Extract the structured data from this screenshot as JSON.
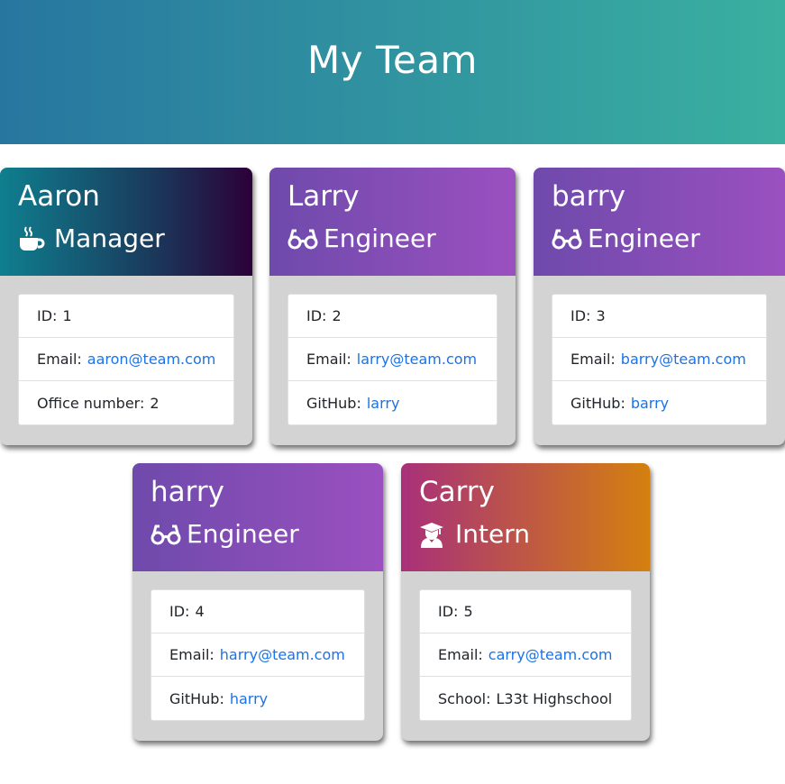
{
  "header": {
    "title": "My Team"
  },
  "labels": {
    "id": "ID:",
    "email": "Email:",
    "office": "Office number:",
    "github": "GitHub:",
    "school": "School:"
  },
  "team": [
    {
      "name": "Aaron",
      "role": "Manager",
      "icon": "coffee-cup-icon",
      "id": "1",
      "email": "aaron@team.com",
      "extra": "2"
    },
    {
      "name": "Larry",
      "role": "Engineer",
      "icon": "glasses-icon",
      "id": "2",
      "email": "larry@team.com",
      "extra": "larry"
    },
    {
      "name": "barry",
      "role": "Engineer",
      "icon": "glasses-icon",
      "id": "3",
      "email": "barry@team.com",
      "extra": "barry"
    },
    {
      "name": "harry",
      "role": "Engineer",
      "icon": "glasses-icon",
      "id": "4",
      "email": "harry@team.com",
      "extra": "harry"
    },
    {
      "name": "Carry",
      "role": "Intern",
      "icon": "graduate-icon",
      "id": "5",
      "email": "carry@team.com",
      "extra": "L33t Highschool"
    }
  ],
  "colors": {
    "link": "#1a73e8",
    "header_start": "#2776a0",
    "header_end": "#3ab0a0",
    "card_body": "#d3d3d3"
  }
}
